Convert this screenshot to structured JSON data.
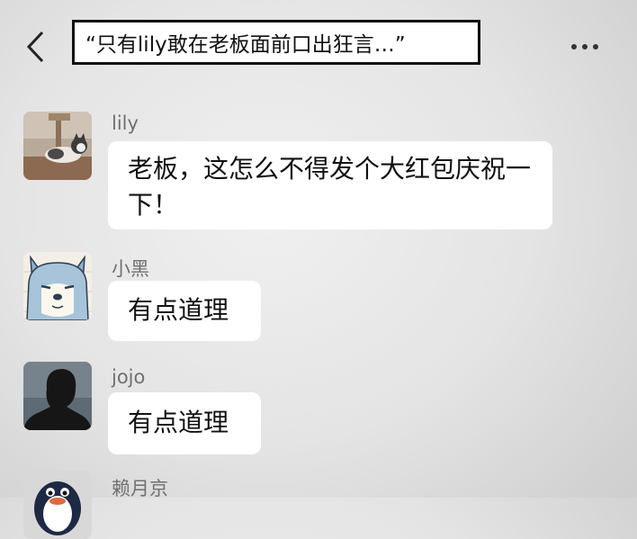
{
  "header": {
    "caption": "“只有lily敢在老板面前口出狂言…”",
    "back_icon": "chevron-left-icon",
    "more_icon": "more-horizontal-icon"
  },
  "messages": [
    {
      "sender": "lily",
      "text": "老板，这怎么不得发个大红包庆祝一下！",
      "avatar": "cat-photo-avatar"
    },
    {
      "sender": "小黑",
      "text": "有点道理",
      "avatar": "shiba-dog-cartoon-avatar"
    },
    {
      "sender": "jojo",
      "text": "有点道理",
      "avatar": "silhouette-avatar"
    },
    {
      "sender": "赖月京",
      "text": "",
      "avatar": "penguin-avatar"
    }
  ],
  "colors": {
    "background": "#e6e6e6",
    "bubble": "#ffffff",
    "sender_name": "#707070",
    "caption_border": "#111111"
  }
}
